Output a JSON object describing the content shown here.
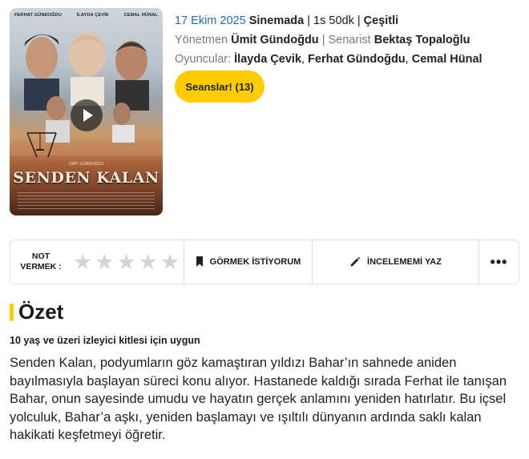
{
  "poster": {
    "credits": [
      "FERHAT GÜNDOĞDU",
      "İLAYDA ÇEVİK",
      "CEMAL HÜNAL"
    ],
    "director_line": "ÜMİT GÜNDOĞDU",
    "title": "SENDEN KALAN"
  },
  "info": {
    "date": "17 Ekim 2025",
    "venue": "Sinemada",
    "duration": "1s 50dk",
    "genre": "Çeşitli",
    "director_label": "Yönetmen",
    "director": "Ümit Gündoğdu",
    "writer_label": "Senarist",
    "writer": "Bektaş Topaloğlu",
    "cast_label": "Oyuncular:",
    "cast": [
      "İlayda Çevik",
      "Ferhat Gündoğdu",
      "Cemal Hünal"
    ]
  },
  "showtimes_button": "Seanslar! (13)",
  "actions": {
    "rate_label_1": "NOT",
    "rate_label_2": "VERMEK :",
    "star_glyph": "★",
    "want_label": "GÖRMEK İSTİYORUM",
    "review_label": "İNCELEMEMİ YAZ",
    "more_label": "•••"
  },
  "summary": {
    "heading": "Özet",
    "age_notice": "10 yaş ve üzeri izleyici kitlesi için uygun",
    "text": "Senden Kalan, podyumların göz kamaştıran yıldızı Bahar’ın sahnede aniden bayılmasıyla başlayan süreci konu alıyor. Hastanede kaldığı sırada Ferhat ile tanışan Bahar, onun sayesinde umudu ve hayatın gerçek anlamını yeniden hatırlatır. Bu içsel yolculuk, Bahar’a aşkı, yeniden başlamayı ve ışıltılı dünyanın ardında saklı kalan hakikati keşfetmeyi öğretir."
  },
  "colors": {
    "accent": "#ffcc00",
    "date": "#1f6fa8",
    "muted": "#7b7b7b",
    "star": "#d4d4d4"
  }
}
